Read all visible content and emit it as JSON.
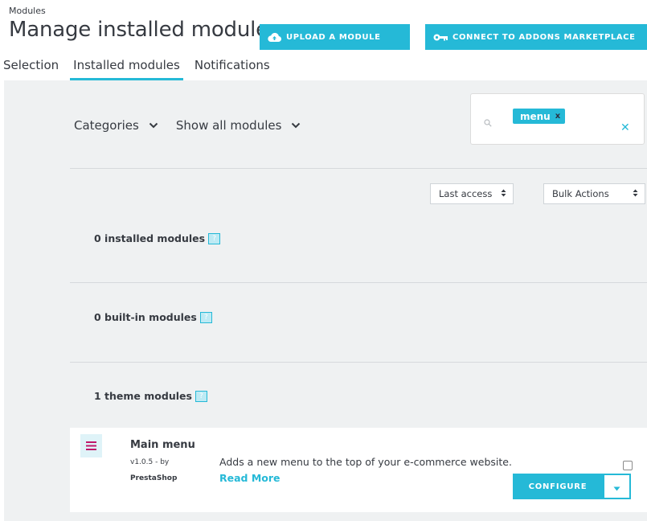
{
  "header": {
    "breadcrumb": "Modules",
    "title": "Manage installed modules",
    "upload_label": "UPLOAD A MODULE",
    "addons_label": "CONNECT TO ADDONS MARKETPLACE"
  },
  "tabs": [
    {
      "label": "Selection",
      "active": false
    },
    {
      "label": "Installed modules",
      "active": true
    },
    {
      "label": "Notifications",
      "active": false
    }
  ],
  "filters": {
    "categories_label": "Categories",
    "show_label": "Show all modules"
  },
  "search": {
    "tag": "menu",
    "tag_remove": "x",
    "clear": "✕"
  },
  "sort": {
    "selected": "Last access",
    "bulk": "Bulk Actions"
  },
  "sections": {
    "installed": "0 installed modules",
    "builtin": "0 built-in modules",
    "theme": "1 theme modules",
    "help_glyph": "?"
  },
  "module": {
    "name": "Main menu",
    "version": "v1.0.5 - by",
    "author": "PrestaShop",
    "description": "Adds a new menu to the top of your e-commerce website.",
    "read_more": "Read More",
    "configure_label": "CONFIGURE",
    "icon": "hamburger-menu-icon"
  },
  "colors": {
    "accent": "#25b9d7",
    "background": "#eff1f2",
    "text": "#363a41",
    "module_icon": "#c0186b"
  }
}
